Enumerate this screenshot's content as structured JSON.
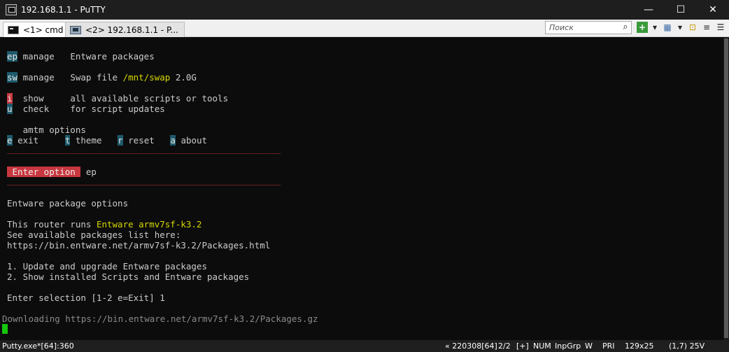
{
  "window": {
    "title": "192.168.1.1 - PuTTY",
    "controls": {
      "minimize": "—",
      "maximize": "☐",
      "close": "✕"
    }
  },
  "tabs": [
    {
      "label": "<1> cmd",
      "icon": "cmd-icon",
      "active": true
    },
    {
      "label": "<2> 192.168.1.1 - P...",
      "icon": "putty-icon",
      "active": false
    }
  ],
  "toolbar": {
    "search_placeholder": "Поиск",
    "search_icon": "search-icon",
    "add_icon": "+",
    "dropdown_icon": "▾",
    "view_icon": "▦",
    "lock_icon": "🔒",
    "settings_icon": "≡",
    "menu_icon": "☰"
  },
  "terminal": {
    "lines": [
      {
        "key": "ep",
        "label": "manage",
        "desc": "Entware packages"
      },
      {
        "key": "sw",
        "label": "manage",
        "desc_pre": "Swap file ",
        "desc_path": "/mnt/swap",
        "desc_post": " 2.0G"
      },
      {
        "key": "i",
        "label": "show",
        "desc": "all available scripts or tools"
      },
      {
        "key": "u",
        "label": "check",
        "desc": "for script updates"
      }
    ],
    "options_title": "amtm options",
    "options": [
      {
        "key": "e",
        "label": "exit"
      },
      {
        "key": "t",
        "label": "theme"
      },
      {
        "key": "r",
        "label": "reset"
      },
      {
        "key": "a",
        "label": "about"
      }
    ],
    "separator": "____________________________________________________",
    "prompt_label": " Enter option ",
    "prompt_value": "ep",
    "section_title": "Entware package options",
    "router_pre": "This router runs ",
    "router_value": "Entware armv7sf-k3.2",
    "list_note": "See available packages list here:",
    "list_url": "https://bin.entware.net/armv7sf-k3.2/Packages.html",
    "menu1": "1. Update and upgrade Entware packages",
    "menu2": "2. Show installed Scripts and Entware packages",
    "selection": "Enter selection [1-2 e=Exit] 1",
    "downloading": "Downloading https://bin.entware.net/armv7sf-k3.2/Packages.gz"
  },
  "status": {
    "process": "Putty.exe*[64]:360",
    "buffer": "« 220308[64]",
    "tabs": "2/2",
    "plus": "[+]",
    "num": "NUM",
    "inp": "InpGrp",
    "w": "W",
    "pri": "PRI",
    "size": "129x25",
    "cursor": "(1,7) 25V"
  }
}
